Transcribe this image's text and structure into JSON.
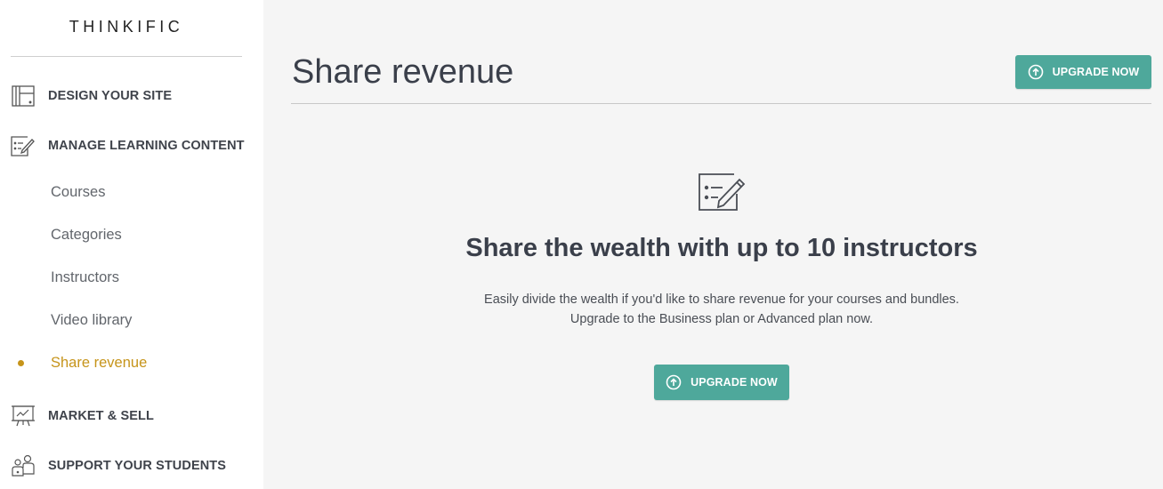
{
  "sidebar": {
    "logo": "THINKIFIC",
    "sections": [
      {
        "label": "DESIGN YOUR SITE",
        "icon": "layout-icon"
      },
      {
        "label": "MANAGE LEARNING CONTENT",
        "icon": "edit-list-icon"
      },
      {
        "label": "MARKET & SELL",
        "icon": "presentation-chart-icon"
      },
      {
        "label": "SUPPORT YOUR STUDENTS",
        "icon": "users-icon"
      }
    ],
    "sub_items": [
      {
        "label": "Courses",
        "active": false
      },
      {
        "label": "Categories",
        "active": false
      },
      {
        "label": "Instructors",
        "active": false
      },
      {
        "label": "Video library",
        "active": false
      },
      {
        "label": "Share revenue",
        "active": true
      }
    ]
  },
  "header": {
    "title": "Share revenue",
    "upgrade_label": "UPGRADE NOW"
  },
  "empty_state": {
    "icon": "edit-list-icon",
    "heading": "Share the wealth with up to 10 instructors",
    "line1": "Easily divide the wealth if you'd like to share revenue for your courses and bundles.",
    "line2": "Upgrade to the Business plan or Advanced plan now.",
    "button_label": "UPGRADE NOW"
  },
  "colors": {
    "accent": "#4ea89b",
    "active_nav": "#c6941a",
    "background": "#f5f5f5",
    "sidebar": "#ffffff"
  }
}
